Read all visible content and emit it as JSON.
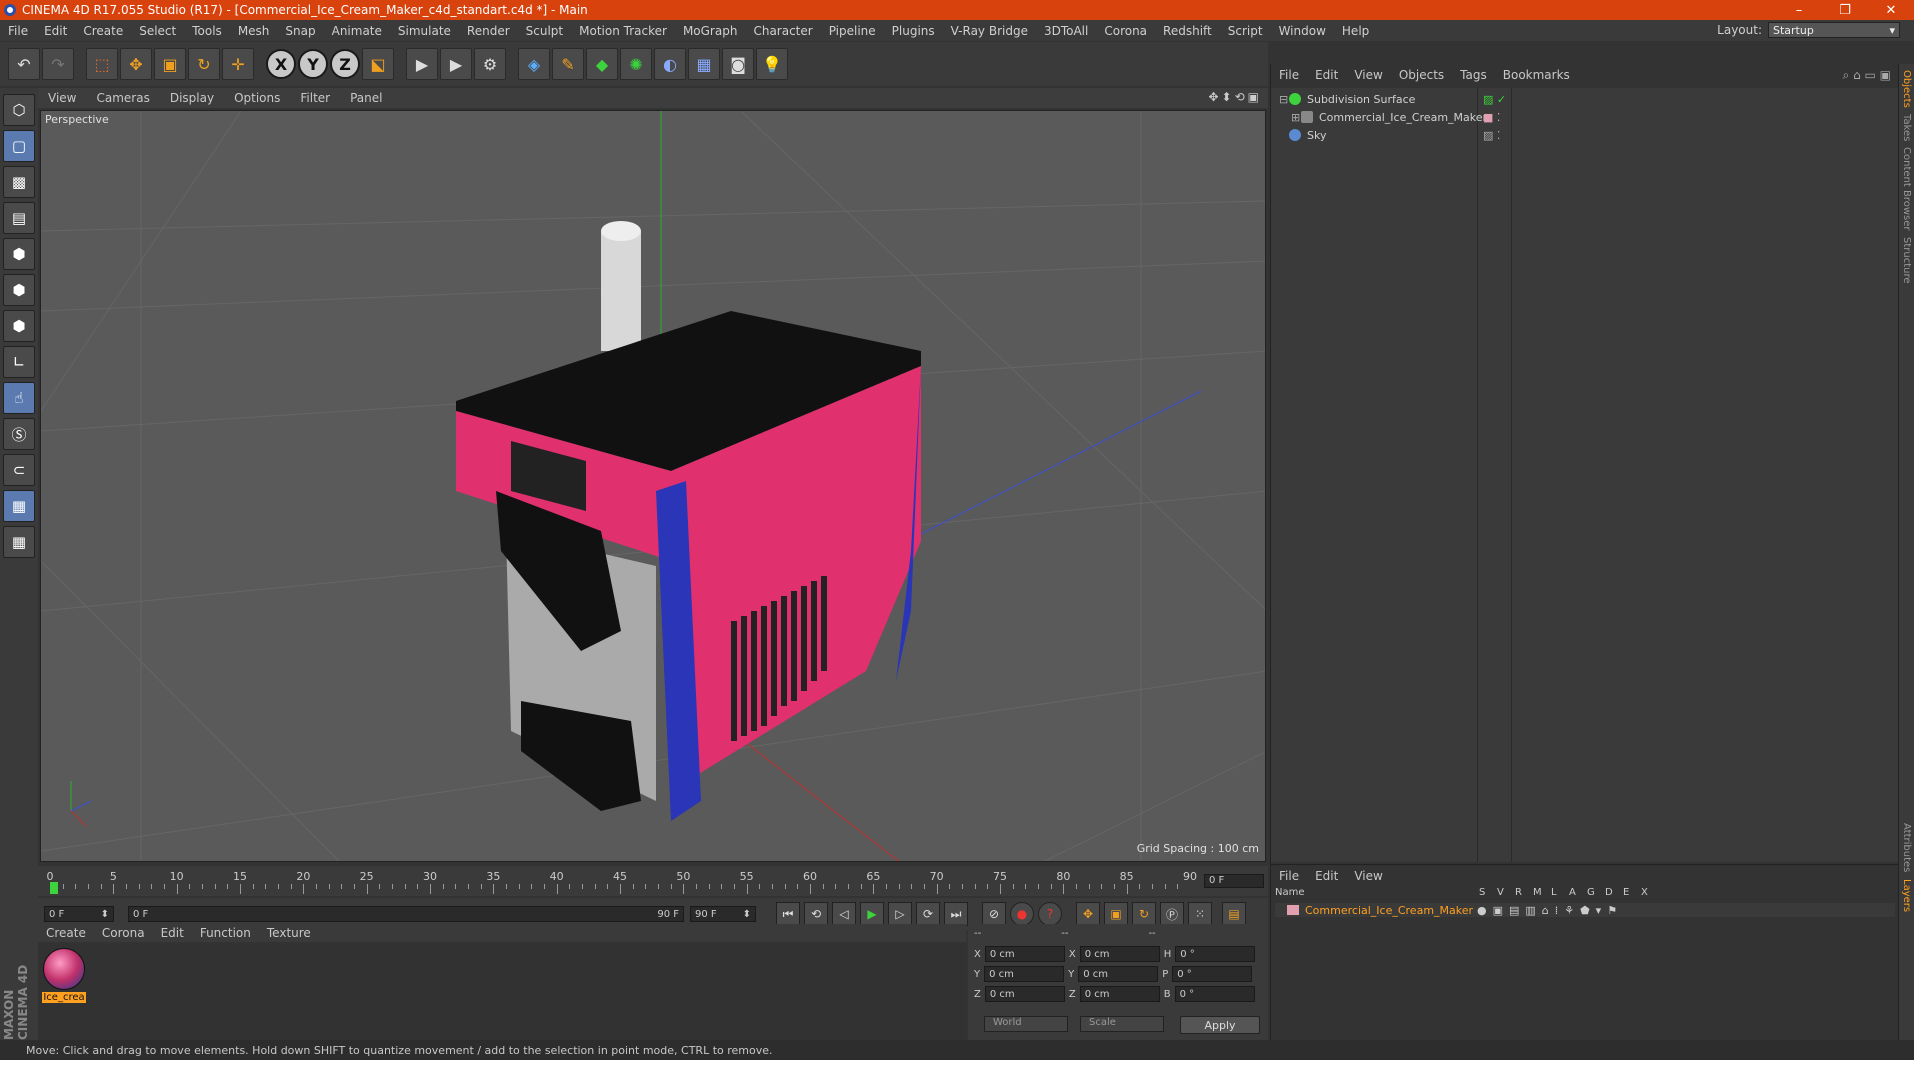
{
  "window": {
    "title": "CINEMA 4D R17.055 Studio (R17) - [Commercial_Ice_Cream_Maker_c4d_standart.c4d *] - Main",
    "controls": [
      "–",
      "❐",
      "✕"
    ]
  },
  "menu": {
    "items": [
      "File",
      "Edit",
      "Create",
      "Select",
      "Tools",
      "Mesh",
      "Snap",
      "Animate",
      "Simulate",
      "Render",
      "Sculpt",
      "Motion Tracker",
      "MoGraph",
      "Character",
      "Pipeline",
      "Plugins",
      "V-Ray Bridge",
      "3DToAll",
      "Corona",
      "Redshift",
      "Script",
      "Window",
      "Help"
    ],
    "layout_label": "Layout:",
    "layout_value": "Startup"
  },
  "toolbar": {
    "axis_x": "X",
    "axis_y": "Y",
    "axis_z": "Z"
  },
  "viewport": {
    "menu": [
      "View",
      "Cameras",
      "Display",
      "Options",
      "Filter",
      "Panel"
    ],
    "label": "Perspective",
    "grid_spacing": "Grid Spacing : 100 cm"
  },
  "timeline": {
    "ticks": [
      "0",
      "5",
      "10",
      "15",
      "20",
      "25",
      "30",
      "35",
      "40",
      "45",
      "50",
      "55",
      "60",
      "65",
      "70",
      "75",
      "80",
      "85",
      "90"
    ],
    "current_frame": "0 F",
    "start_field": "0 F",
    "range_start": "0 F",
    "range_end": "90 F",
    "end_field": "90 F"
  },
  "material_manager": {
    "menu": [
      "Create",
      "Corona",
      "Edit",
      "Function",
      "Texture"
    ],
    "material_name": "Ice_crea"
  },
  "coordinates": {
    "header": [
      "--",
      "--",
      "--"
    ],
    "rows": [
      {
        "a": "X",
        "av": "0 cm",
        "b": "X",
        "bv": "0 cm",
        "c": "H",
        "cv": "0 °"
      },
      {
        "a": "Y",
        "av": "0 cm",
        "b": "Y",
        "bv": "0 cm",
        "c": "P",
        "cv": "0 °"
      },
      {
        "a": "Z",
        "av": "0 cm",
        "b": "Z",
        "bv": "0 cm",
        "c": "B",
        "cv": "0 °"
      }
    ],
    "mode1": "World",
    "mode2": "Scale",
    "apply": "Apply"
  },
  "object_manager": {
    "menu": [
      "File",
      "Edit",
      "View",
      "Objects",
      "Tags",
      "Bookmarks"
    ],
    "objects": [
      "Subdivision Surface",
      "Commercial_Ice_Cream_Maker",
      "Sky"
    ]
  },
  "layer_manager": {
    "menu": [
      "File",
      "Edit",
      "View"
    ],
    "columns": [
      "Name",
      "S",
      "V",
      "R",
      "M",
      "L",
      "A",
      "G",
      "D",
      "E",
      "X"
    ],
    "row_name": "Commercial_Ice_Cream_Maker"
  },
  "right_tabs": [
    "Objects",
    "Takes",
    "Content Browser",
    "Structure",
    "Attributes",
    "Layers"
  ],
  "branding": "MAXON CINEMA 4D",
  "status": "Move: Click and drag to move elements. Hold down SHIFT to quantize movement / add to the selection in point mode, CTRL to remove.",
  "colors": {
    "titlebar": "#d8420d",
    "pink": "#e0306e",
    "blue": "#2a35b8",
    "highlight": "#ffa020"
  }
}
